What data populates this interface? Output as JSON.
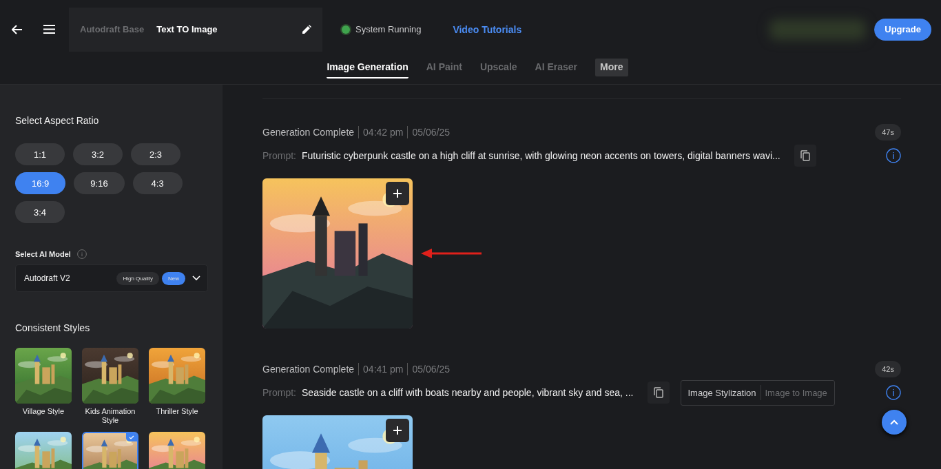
{
  "header": {
    "breadcrumb": "Autodraft Base",
    "title": "Text TO Image",
    "status": {
      "label": "System Running",
      "on": true
    },
    "link": "Video Tutorials",
    "upgrade": "Upgrade"
  },
  "tabs": [
    {
      "label": "Image Generation",
      "selected": true
    },
    {
      "label": "AI Paint",
      "selected": false
    },
    {
      "label": "Upscale",
      "selected": false
    },
    {
      "label": "AI Eraser",
      "selected": false
    },
    {
      "label": "More",
      "selected": false,
      "kind": "menu"
    }
  ],
  "sidebar": {
    "aspect_title": "Select Aspect Ratio",
    "ratios": [
      {
        "label": "1:1",
        "selected": false
      },
      {
        "label": "3:2",
        "selected": false
      },
      {
        "label": "2:3",
        "selected": false
      },
      {
        "label": "16:9",
        "selected": true
      },
      {
        "label": "9:16",
        "selected": false
      },
      {
        "label": "4:3",
        "selected": false
      },
      {
        "label": "3:4",
        "selected": false
      }
    ],
    "model_title": "Select AI Model",
    "model": {
      "name": "Autodraft V2",
      "badges": [
        {
          "label": "High Quality",
          "kind": "plain"
        },
        {
          "label": "New",
          "kind": "accent"
        }
      ]
    },
    "styles_title": "Consistent Styles",
    "styles": [
      {
        "label": "Village Style",
        "selected": false,
        "kind": "picture"
      },
      {
        "label": "Kids Animation Style",
        "selected": false,
        "kind": "picture"
      },
      {
        "label": "Thriller Style",
        "selected": false,
        "kind": "picture"
      },
      {
        "selected": false,
        "kind": "picture"
      },
      {
        "selected": true,
        "kind": "picture"
      },
      {
        "selected": false,
        "kind": "picture"
      }
    ]
  },
  "generations": [
    {
      "status": "Generation Complete",
      "time": "04:42 pm",
      "date": "05/06/25",
      "duration": "47s",
      "prompt_label": "Prompt:",
      "prompt": "Futuristic cyberpunk castle on a high cliff at sunrise, with glowing neon accents on towers, digital banners wavi...",
      "image": {
        "kind": "picture"
      },
      "annotated": true
    },
    {
      "status": "Generation Complete",
      "time": "04:41 pm",
      "date": "05/06/25",
      "duration": "42s",
      "prompt_label": "Prompt:",
      "prompt": "Seaside castle on a cliff with boats nearby and people, vibrant sky and sea, ...",
      "tags": [
        "Image Stylization",
        "Image to Image"
      ],
      "image": {
        "kind": "picture"
      },
      "annotated": false
    }
  ]
}
